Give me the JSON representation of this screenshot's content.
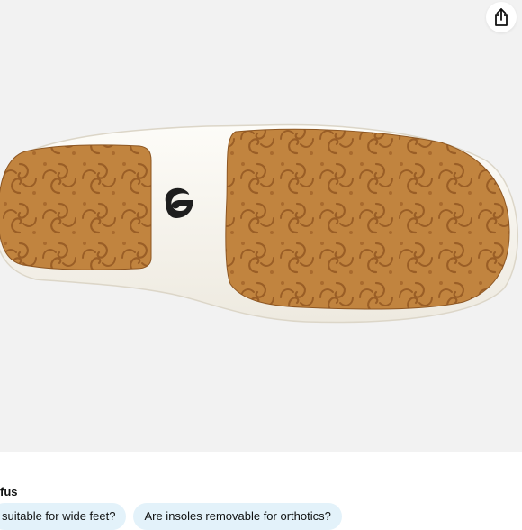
{
  "share": {
    "icon": "share-icon"
  },
  "product_image": {
    "logo_icon": "olukai-logo-icon"
  },
  "rufus": {
    "label": "fus",
    "questions": [
      {
        "label": "suitable for wide feet?"
      },
      {
        "label": "Are insoles removable for orthotics?"
      }
    ]
  },
  "colors": {
    "background": "#f2f2f2",
    "sole_rubber": "#faf8f3",
    "tread": "#c1843f",
    "chip": "#e3f2fa"
  }
}
